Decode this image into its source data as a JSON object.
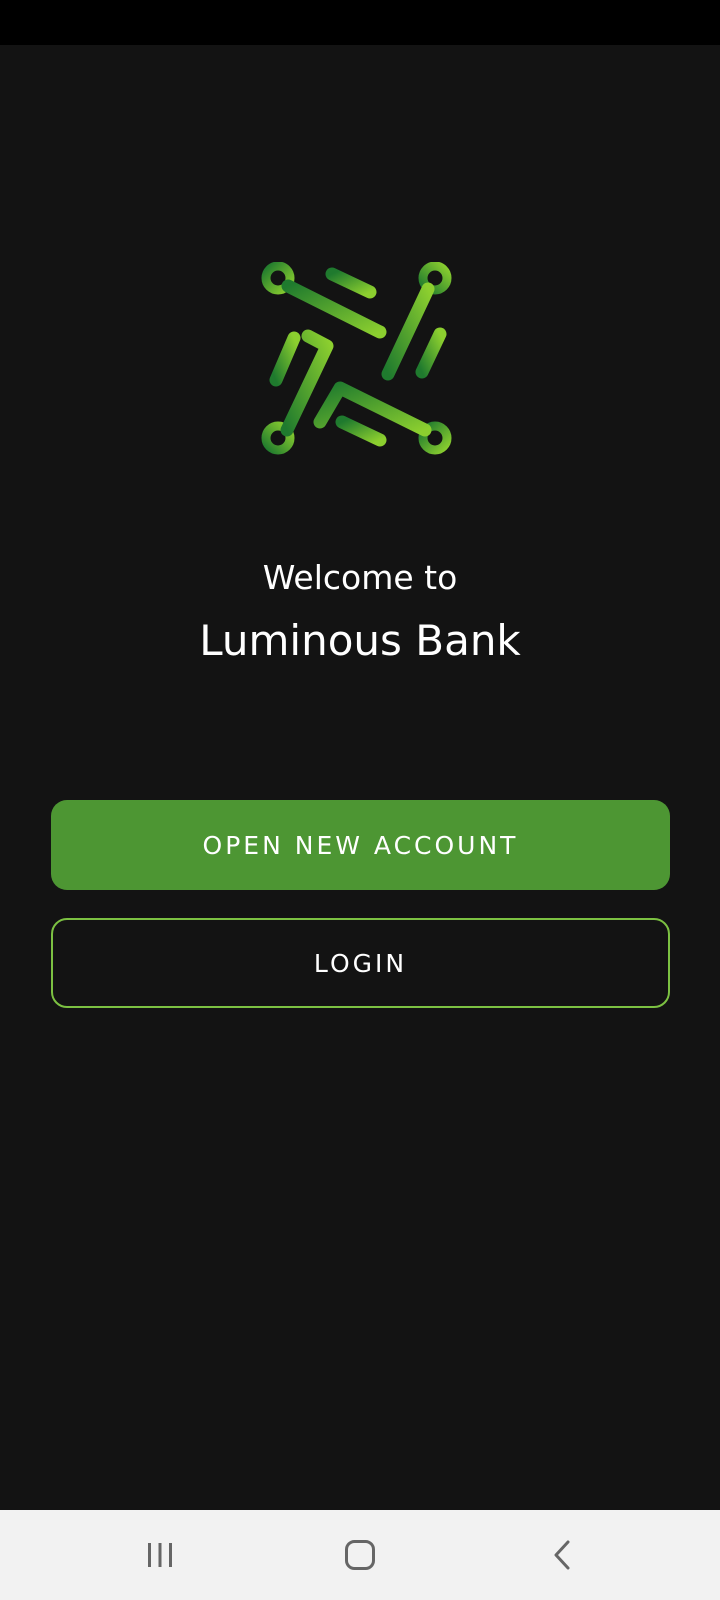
{
  "welcome": {
    "line1": "Welcome to",
    "bank_name": "Luminous Bank"
  },
  "buttons": {
    "open_account_label": "OPEN NEW ACCOUNT",
    "login_label": "LOGIN"
  },
  "nav": {
    "recents_icon": "recents-icon",
    "home_icon": "home-icon",
    "back_icon": "back-icon"
  },
  "colors": {
    "background": "#131313",
    "status_bar": "#000000",
    "primary_button": "#4d9633",
    "login_border": "#7cc142",
    "logo_dark_green": "#1f7a2e",
    "logo_light_green": "#8ccf2f",
    "nav_bar": "#f2f2f2"
  }
}
